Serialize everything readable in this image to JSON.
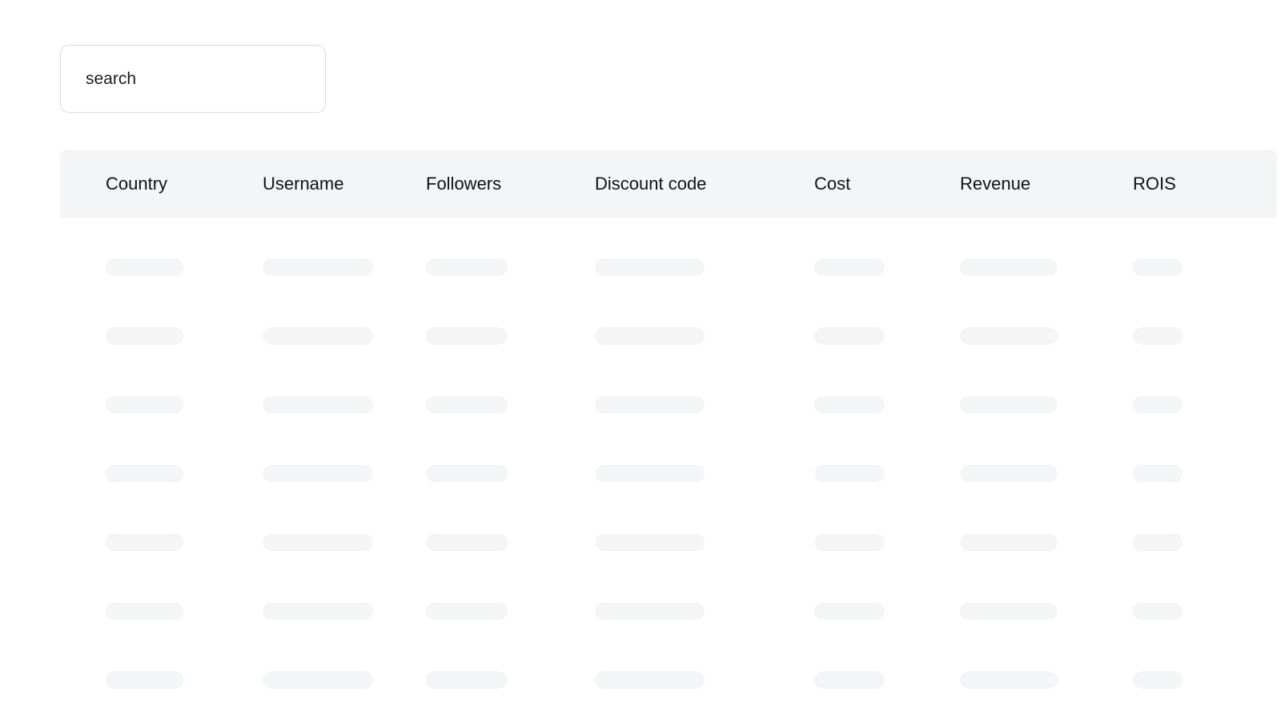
{
  "search": {
    "placeholder": "search",
    "value": ""
  },
  "table": {
    "columns": [
      {
        "key": "country",
        "label": "Country",
        "skeleton_width": 97
      },
      {
        "key": "username",
        "label": "Username",
        "skeleton_width": 138
      },
      {
        "key": "followers",
        "label": "Followers",
        "skeleton_width": 102
      },
      {
        "key": "discount_code",
        "label": "Discount code",
        "skeleton_width": 137
      },
      {
        "key": "cost",
        "label": "Cost",
        "skeleton_width": 88
      },
      {
        "key": "revenue",
        "label": "Revenue",
        "skeleton_width": 122
      },
      {
        "key": "rois",
        "label": "ROIS",
        "skeleton_width": 62
      }
    ],
    "rows": [
      {
        "loading": true
      },
      {
        "loading": true
      },
      {
        "loading": true
      },
      {
        "loading": true
      },
      {
        "loading": true
      },
      {
        "loading": true
      },
      {
        "loading": true
      }
    ],
    "state": "loading",
    "row_count": 7
  },
  "colors": {
    "page_background": "#ffffff",
    "header_background": "#f4f5f7",
    "skeleton": "#f4f5f7",
    "input_border": "#d8dce2",
    "text": "#101113"
  }
}
